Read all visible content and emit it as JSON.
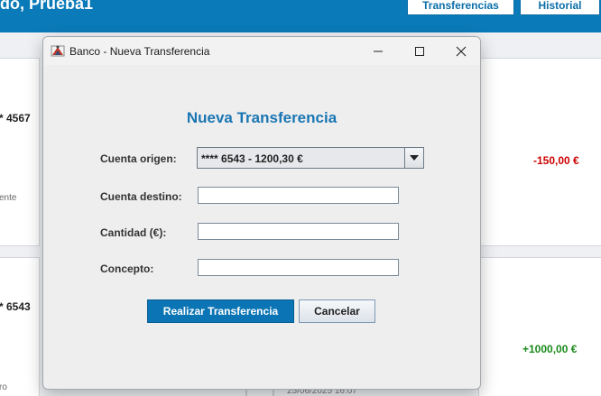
{
  "app": {
    "greeting": "do, Prueba1",
    "nav": {
      "transfers_label": "Transferencias",
      "history_label": "Historial"
    },
    "accounts": [
      {
        "number": "* 4567",
        "type": "ente"
      },
      {
        "number": "* 6543",
        "type": "ro"
      }
    ],
    "transactions": [
      {
        "amount": "-150,00 €",
        "color": "#cc0000"
      },
      {
        "amount": "+1000,00 €",
        "color": "#1a8a1a",
        "date": "25/06/2025 16:07"
      }
    ]
  },
  "dialog": {
    "title": "Banco - Nueva Transferencia",
    "heading": "Nueva Transferencia",
    "fields": {
      "origin_label": "Cuenta origen:",
      "origin_value": "**** 6543 - 1200,30 €",
      "destination_label": "Cuenta destino:",
      "destination_value": "",
      "amount_label": "Cantidad (€):",
      "amount_value": "",
      "concept_label": "Concepto:",
      "concept_value": ""
    },
    "buttons": {
      "submit_label": "Realizar Transferencia",
      "cancel_label": "Cancelar"
    },
    "icons": [
      "app-icon",
      "minimize-icon",
      "maximize-icon",
      "close-icon",
      "chevron-down-icon"
    ],
    "colors": {
      "accent": "#0a74b4",
      "heading": "#1a76b3"
    }
  }
}
